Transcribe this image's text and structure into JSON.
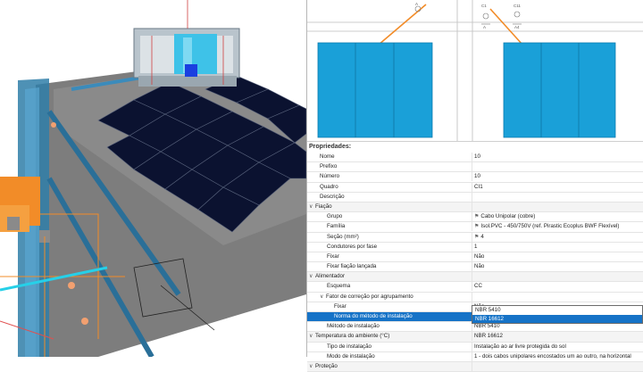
{
  "diagram": {
    "left_circuit": {
      "label": "C1",
      "sub": "A"
    },
    "right_circuit": {
      "label": "C11",
      "sub": "A4"
    },
    "top_tag": "A"
  },
  "properties": {
    "title": "Propriedades:",
    "rows": [
      {
        "label": "Nome",
        "value": "10",
        "type": "sub1"
      },
      {
        "label": "Prefixo",
        "value": "",
        "type": "sub1"
      },
      {
        "label": "Número",
        "value": "10",
        "type": "sub1"
      },
      {
        "label": "Quadro",
        "value": "CI1",
        "type": "sub1"
      },
      {
        "label": "Descrição",
        "value": "",
        "type": "sub1"
      },
      {
        "label": "Fiação",
        "value": "",
        "type": "cat"
      },
      {
        "label": "Grupo",
        "value": "Cabo Unipolar (cobre)",
        "type": "sub2",
        "icon": "pin-icon"
      },
      {
        "label": "Família",
        "value": "Isol.PVC - 450/750V (ref. Pirastic Ecoplus BWF Flexível)",
        "type": "sub2",
        "icon": "pin-icon"
      },
      {
        "label": "Seção (mm²)",
        "value": "4",
        "type": "sub2",
        "icon": "pin-icon"
      },
      {
        "label": "Condutores por fase",
        "value": "1",
        "type": "sub2"
      },
      {
        "label": "Fixar",
        "value": "Não",
        "type": "sub2"
      },
      {
        "label": "Fixar fiação lançada",
        "value": "Não",
        "type": "sub2"
      },
      {
        "label": "Alimentador",
        "value": "",
        "type": "cat"
      },
      {
        "label": "Esquema",
        "value": "CC",
        "type": "sub2"
      },
      {
        "label": "Fator de correção por agrupamento",
        "value": "",
        "type": "subcat"
      },
      {
        "label": "Fixar",
        "value": "Não",
        "type": "sub3"
      },
      {
        "label": "Norma do método de instalação",
        "value": "NBR 16612",
        "type": "sel"
      },
      {
        "label": "Método de instalação",
        "value": "NBR 5410",
        "type": "sub2"
      },
      {
        "label": "Temperatura do ambiente (°C)",
        "value": "NBR 16612",
        "type": "cat"
      },
      {
        "label": "Tipo de instalação",
        "value": "Instalação ao ar livre protegida do sol",
        "type": "sub2"
      },
      {
        "label": "Modo de instalação",
        "value": "1 - dois cabos unipolares encostados um ao outro, na horizontal",
        "type": "sub2"
      },
      {
        "label": "Proteção",
        "value": "",
        "type": "cat"
      }
    ]
  },
  "dropdown": {
    "options": [
      "NBR 5410",
      "NBR 16612"
    ],
    "highlighted": 1
  },
  "colors": {
    "selection": "#1673c7",
    "panel_blue": "#1aa0d8",
    "wire_orange": "#f28c28",
    "solar_panel": "#0b1230"
  }
}
